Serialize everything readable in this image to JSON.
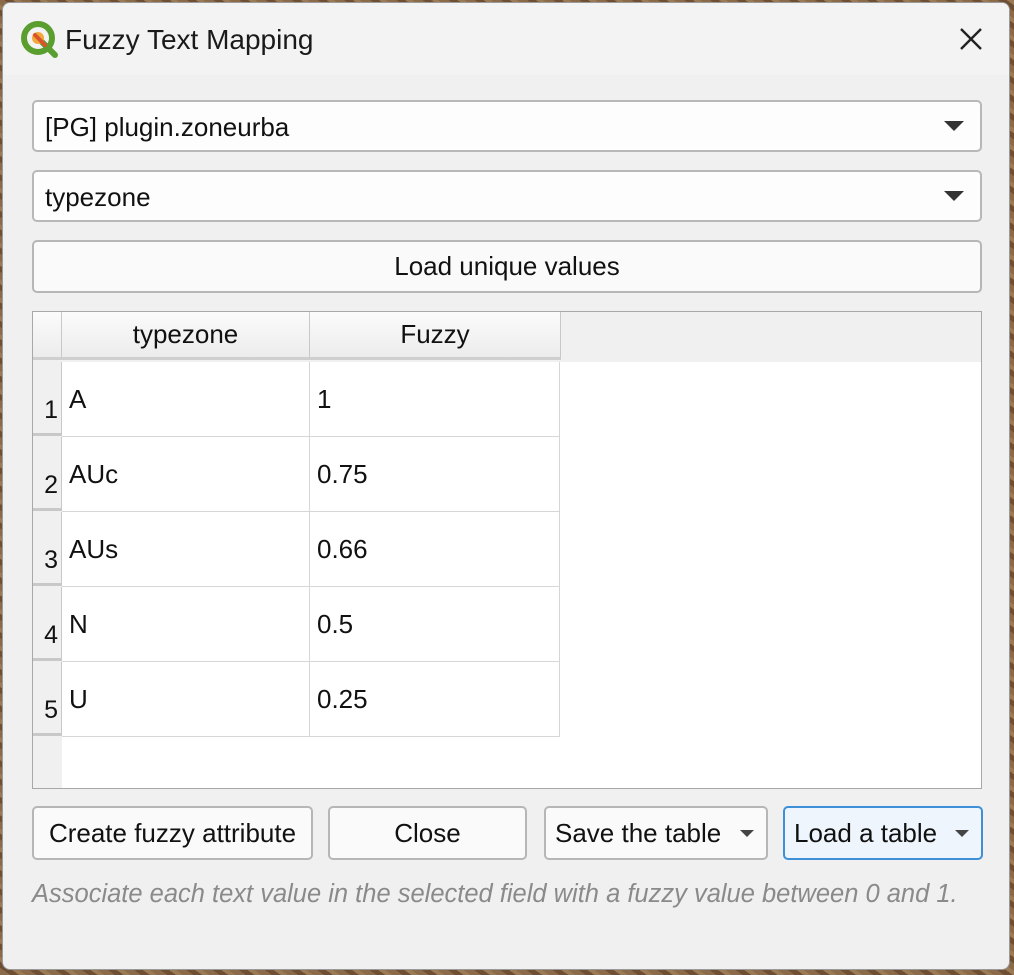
{
  "window": {
    "title": "Fuzzy Text Mapping"
  },
  "layer_combo": {
    "value": "[PG] plugin.zoneurba"
  },
  "field_combo": {
    "value": "typezone"
  },
  "load_unique_button": "Load unique values",
  "table": {
    "columns": [
      "typezone",
      "Fuzzy"
    ],
    "rows": [
      {
        "num": "1",
        "value": "A",
        "fuzzy": "1"
      },
      {
        "num": "2",
        "value": "AUc",
        "fuzzy": "0.75"
      },
      {
        "num": "3",
        "value": "AUs",
        "fuzzy": "0.66"
      },
      {
        "num": "4",
        "value": "N",
        "fuzzy": "0.5"
      },
      {
        "num": "5",
        "value": "U",
        "fuzzy": "0.25"
      }
    ]
  },
  "buttons": {
    "create": "Create fuzzy attribute",
    "close": "Close",
    "save": "Save the table",
    "load": "Load a table"
  },
  "hint": "Associate each text value in the selected field with a fuzzy value between 0 and 1.",
  "icons": {
    "app": "qgis-logo-icon",
    "close": "close-icon"
  },
  "colors": {
    "accent": "#3d8fd8",
    "hint_text": "#8a8a8a"
  }
}
